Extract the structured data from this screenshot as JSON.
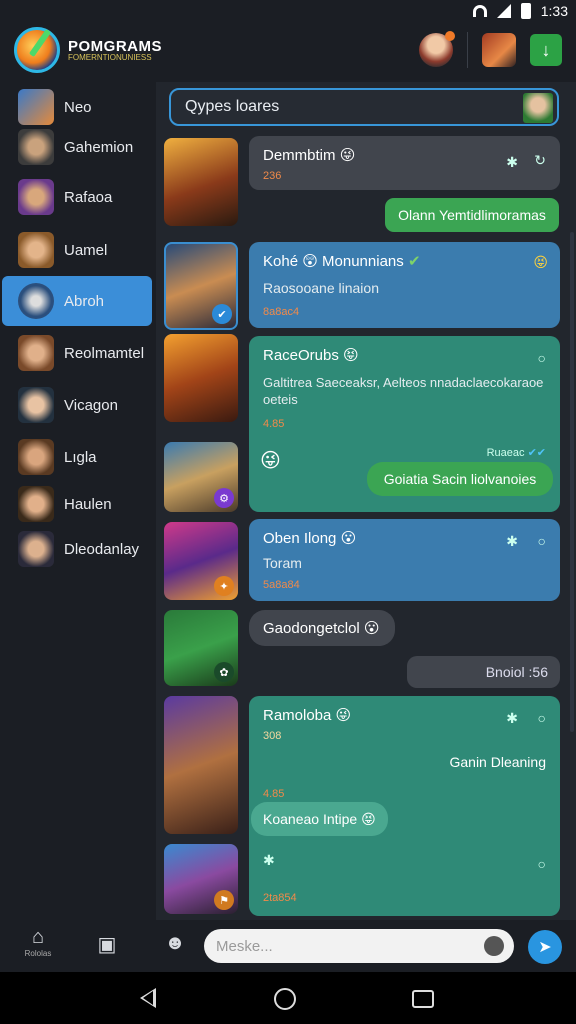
{
  "status_bar": {
    "time": "1:33"
  },
  "app": {
    "brand_name": "POMGRAMS",
    "brand_tagline": "FOMERNTIONUNIESS"
  },
  "search": {
    "text": "Qypes loares"
  },
  "sidebar": {
    "items": [
      {
        "label": "Neo"
      },
      {
        "label": "Gahemion"
      },
      {
        "label": "Rafaoa"
      },
      {
        "label": "Uamel"
      },
      {
        "label": "Abroh",
        "active": true
      },
      {
        "label": "Reolmamtel"
      },
      {
        "label": "Vicagon"
      },
      {
        "label": "Lıgla"
      },
      {
        "label": "Haulen"
      },
      {
        "label": "Dleodanlay"
      }
    ]
  },
  "messages": {
    "m1": {
      "title": "Demmbtim",
      "emoji": "😜",
      "meta": "236"
    },
    "m2": {
      "text": "Olann Yemtidlimoramas"
    },
    "m3": {
      "title": "Kohé",
      "emoji1": "😲",
      "title2": "Monunnians",
      "sub": "Raosooane linaion",
      "meta": "8a8ac4"
    },
    "m4": {
      "title": "RaceOrubs",
      "emoji": "😝",
      "sub": "Galtitrea Saeceaksr, Aelteos nnadaclaecokaraoe oeteis",
      "meta": "4.85",
      "status": "Ruaeac",
      "reply": "Goiatia Sacin liolvanoies"
    },
    "m5": {
      "title": "Oben Ilong",
      "emoji": "😮",
      "sub": "Toram",
      "meta": "5a8a84"
    },
    "m6": {
      "title": "Gaodongetclol",
      "emoji": "😮"
    },
    "m7": {
      "text": "Bnoiol :56"
    },
    "m8": {
      "title": "Ramoloba",
      "emoji": "😜",
      "meta": "308",
      "right_text": "Ganin Dleaning",
      "meta2": "4.85",
      "inner": "Koaneao Intipe",
      "meta3": "2ta854"
    }
  },
  "composer": {
    "placeholder": "Meske..."
  },
  "bottom_nav": {
    "home_label": "Rololas"
  }
}
